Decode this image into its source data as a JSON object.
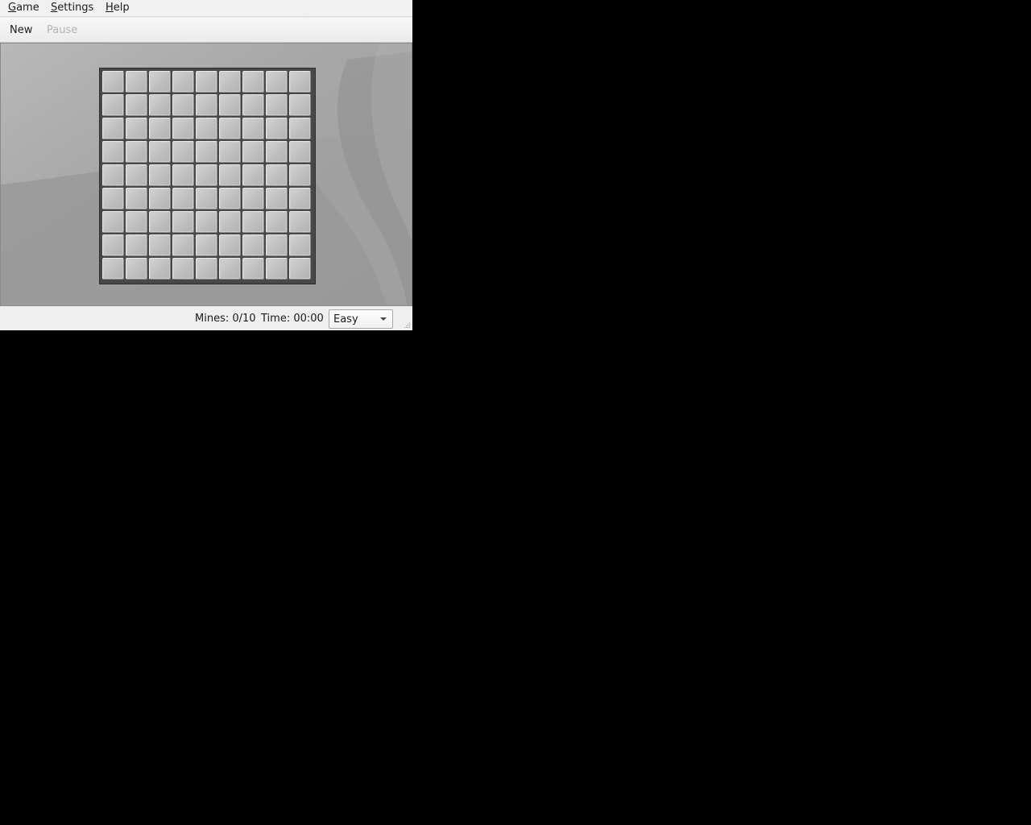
{
  "menubar": {
    "items": [
      {
        "mnemonic": "G",
        "rest": "ame"
      },
      {
        "mnemonic": "S",
        "rest": "ettings"
      },
      {
        "mnemonic": "H",
        "rest": "elp"
      }
    ]
  },
  "toolbar": {
    "new_label": "New",
    "pause_label": "Pause"
  },
  "board": {
    "rows": 9,
    "cols": 9
  },
  "status": {
    "mines": "Mines: 0/10",
    "time": "Time: 00:00",
    "difficulty": "Easy"
  },
  "icons": {
    "dropdown": "chevron-down-icon",
    "resize": "resize-grip-icon"
  }
}
